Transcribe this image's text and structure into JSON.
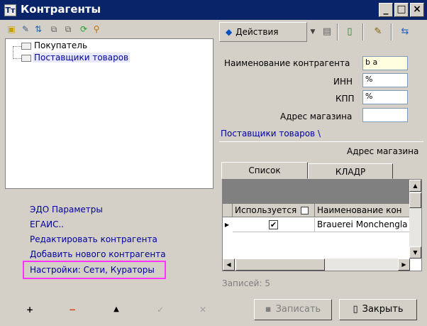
{
  "window": {
    "title": "Контрагенты",
    "icon_text": "Tт",
    "minimize": "_",
    "maximize": "□",
    "close": "×"
  },
  "tree": {
    "items": [
      {
        "label": "Покупатель"
      },
      {
        "label": "Поставщики товаров"
      }
    ]
  },
  "links": [
    {
      "label": "ЭДО Параметры"
    },
    {
      "label": "ЕГАИС.."
    },
    {
      "label": "Редактировать контрагента"
    },
    {
      "label": "Добавить нового контрагента"
    },
    {
      "label": "Настройки: Сети, Кураторы"
    }
  ],
  "bottom_left_toolbar": {
    "add": "+",
    "remove": "−",
    "up": "▲",
    "confirm": "✓",
    "cancel": "✕"
  },
  "toolbar": {
    "actions_label": "Действия",
    "actions_icon": "◆"
  },
  "form": {
    "name_label": "Наименование контрагента",
    "name_value": "b a",
    "inn_label": "ИНН",
    "inn_value": "%",
    "kpp_label": "КПП",
    "kpp_value": "%",
    "address_label": "Адрес магазина",
    "address_value": ""
  },
  "path": "Поставщики товаров \\",
  "address_column_header": "Адрес магазина",
  "tabs": [
    {
      "label": "Список"
    },
    {
      "label": "КЛАДР"
    }
  ],
  "grid": {
    "columns": [
      "Используется",
      "Наименование кон"
    ],
    "rows": [
      {
        "used": "✔",
        "name": "Brauerei Monchengla"
      }
    ]
  },
  "records_label": "Записей: 5",
  "buttons": {
    "save": "Записать",
    "close": "Закрыть"
  },
  "colors": {
    "titlebar": "#0a246a",
    "highlight": "#ff33ff",
    "link": "#0000a0",
    "name_input_bg": "#ffffe0"
  }
}
